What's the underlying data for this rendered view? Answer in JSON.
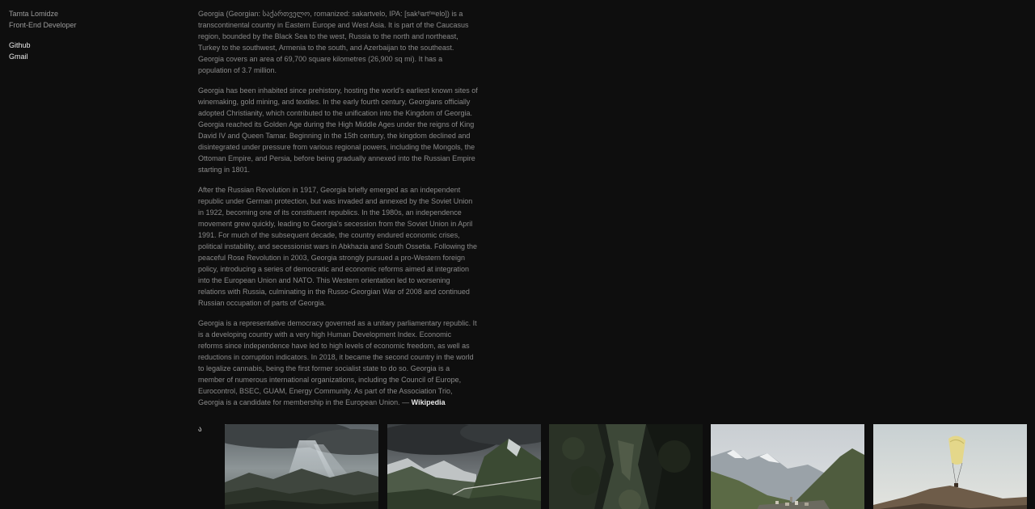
{
  "sidebar": {
    "name": "Tamta Lomidze",
    "role": "Front-End Developer",
    "links": [
      "Github",
      "Gmail"
    ]
  },
  "article": {
    "paragraphs": [
      "Georgia (Georgian: საქართველო, romanized: sakartvelo, IPA: [sakʰartʰʷelo]) is a transcontinental country in Eastern Europe and West Asia. It is part of the Caucasus region, bounded by the Black Sea to the west, Russia to the north and northeast, Turkey to the southwest, Armenia to the south, and Azerbaijan to the southeast. Georgia covers an area of 69,700 square kilometres (26,900 sq mi). It has a population of 3.7 million.",
      "Georgia has been inhabited since prehistory, hosting the world's earliest known sites of winemaking, gold mining, and textiles. In the early fourth century, Georgians officially adopted Christianity, which contributed to the unification into the Kingdom of Georgia. Georgia reached its Golden Age during the High Middle Ages under the reigns of King David IV and Queen Tamar. Beginning in the 15th century, the kingdom declined and disintegrated under pressure from various regional powers, including the Mongols, the Ottoman Empire, and Persia, before being gradually annexed into the Russian Empire starting in 1801.",
      "After the Russian Revolution in 1917, Georgia briefly emerged as an independent republic under German protection, but was invaded and annexed by the Soviet Union in 1922, becoming one of its constituent republics. In the 1980s, an independence movement grew quickly, leading to Georgia's secession from the Soviet Union in April 1991. For much of the subsequent decade, the country endured economic crises, political instability, and secessionist wars in Abkhazia and South Ossetia. Following the peaceful Rose Revolution in 2003, Georgia strongly pursued a pro-Western foreign policy, introducing a series of democratic and economic reforms aimed at integration into the European Union and NATO. This Western orientation led to worsening relations with Russia, culminating in the Russo-Georgian War of 2008 and continued Russian occupation of parts of Georgia."
    ],
    "last_paragraph": "Georgia is a representative democracy governed as a unitary parliamentary republic. It is a developing country with a very high Human Development Index. Economic reforms since independence have led to high levels of economic freedom, as well as reductions in corruption indicators. In 2018, it became the second country in the world to legalize cannabis, being the first former socialist state to do so. Georgia is a member of numerous international organizations, including the Council of Europe, Eurocontrol, BSEC, GUAM, Energy Community. As part of the Association Trio, Georgia is a candidate for membership in the European Union. —",
    "source": "Wikipedia"
  },
  "gallery": {
    "letter": "ა",
    "photos": [
      {
        "name": "mountain-sunrays-photo"
      },
      {
        "name": "green-valley-road-photo"
      },
      {
        "name": "forest-cliff-photo"
      },
      {
        "name": "mountain-village-photo"
      },
      {
        "name": "paraglider-photo"
      }
    ]
  }
}
